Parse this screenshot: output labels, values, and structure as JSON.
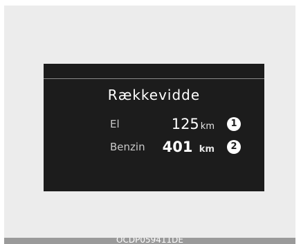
{
  "display": {
    "title": "Rækkevidde",
    "rows": [
      {
        "label": "El",
        "value": "125",
        "unit": "km",
        "callout": "1"
      },
      {
        "label": "Benzin",
        "value": "401",
        "unit": "km",
        "callout": "2"
      }
    ]
  },
  "caption": "OCDP059411DE",
  "colors": {
    "screen_background": "#1c1c1c",
    "frame_background": "#ececec",
    "text": "#ffffff",
    "caption_bar": "#9a9a9a"
  }
}
